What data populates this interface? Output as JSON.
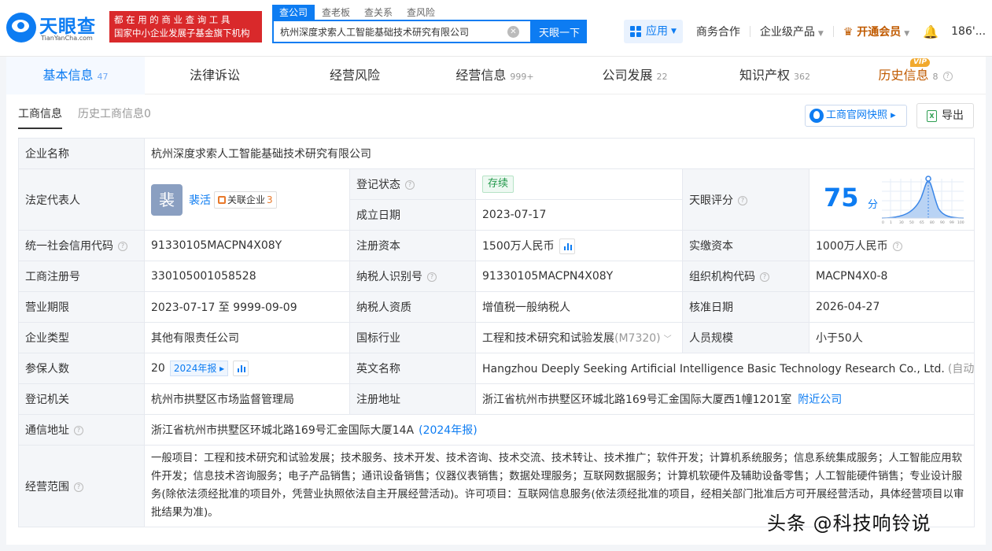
{
  "header": {
    "logo_text": "天眼查",
    "logo_domain": "TianYanCha.com",
    "slogan_line1": "都在用的商业查询工具",
    "slogan_line2": "国家中小企业发展子基金旗下机构",
    "search_tabs": [
      "查公司",
      "查老板",
      "查关系",
      "查风险"
    ],
    "search_value": "杭州深度求索人工智能基础技术研究有限公司",
    "clear_symbol": "✕",
    "search_button": "天眼一下",
    "nav": {
      "apps": "应用",
      "business": "商务合作",
      "enterprise": "企业级产品",
      "vip": "开通会员",
      "vip_icon": "♛",
      "bell_icon": "🔔",
      "user": "186'..."
    }
  },
  "tabs": [
    {
      "label": "基本信息",
      "count": "47"
    },
    {
      "label": "法律诉讼",
      "count": ""
    },
    {
      "label": "经营风险",
      "count": ""
    },
    {
      "label": "经营信息",
      "count": "999+"
    },
    {
      "label": "公司发展",
      "count": "22"
    },
    {
      "label": "知识产权",
      "count": "362"
    },
    {
      "label": "历史信息",
      "count": "8",
      "badge": "VIP"
    }
  ],
  "subtabs": [
    "工商信息",
    "历史工商信息0"
  ],
  "actions": {
    "snapshot": "工商官网快照",
    "snapshot_arrow": "▸",
    "export": "导出",
    "export_icon": "X"
  },
  "info": {
    "company_name_label": "企业名称",
    "company_name": "杭州深度求索人工智能基础技术研究有限公司",
    "legal_rep_label": "法定代表人",
    "legal_rep_avatar": "裴",
    "legal_rep_name": "裴活",
    "related_label": "关联企业",
    "related_count": "3",
    "reg_status_label": "登记状态",
    "reg_status": "存续",
    "founded_label": "成立日期",
    "founded": "2023-07-17",
    "score_label": "天眼评分",
    "score": "75",
    "score_unit": "分",
    "credit_code_label": "统一社会信用代码",
    "credit_code": "91330105MACPN4X08Y",
    "reg_capital_label": "注册资本",
    "reg_capital": "1500万人民币",
    "paid_capital_label": "实缴资本",
    "paid_capital": "1000万人民币",
    "reg_no_label": "工商注册号",
    "reg_no": "330105001058528",
    "taxpayer_id_label": "纳税人识别号",
    "taxpayer_id": "91330105MACPN4X08Y",
    "org_code_label": "组织机构代码",
    "org_code": "MACPN4X0-8",
    "term_label": "营业期限",
    "term": "2023-07-17 至 9999-09-09",
    "taxpayer_qual_label": "纳税人资质",
    "taxpayer_qual": "增值税一般纳税人",
    "approval_date_label": "核准日期",
    "approval_date": "2026-04-27",
    "type_label": "企业类型",
    "type": "其他有限责任公司",
    "industry_label": "国标行业",
    "industry": "工程和技术研究和试验发展",
    "industry_code": "(M7320)",
    "staff_size_label": "人员规模",
    "staff_size": "小于50人",
    "insured_label": "参保人数",
    "insured": "20",
    "insured_year": "2024年报 ▸",
    "english_name_label": "英文名称",
    "english_name": "Hangzhou Deeply Seeking Artificial Intelligence Basic Technology Research Co., Ltd.",
    "auto_translate": "(自动翻译)",
    "authority_label": "登记机关",
    "authority": "杭州市拱墅区市场监督管理局",
    "reg_address_label": "注册地址",
    "reg_address": "浙江省杭州市拱墅区环城北路169号汇金国际大厦西1幢1201室",
    "nearby": "附近公司",
    "mail_address_label": "通信地址",
    "mail_address": "浙江省杭州市拱墅区环城北路169号汇金国际大厦14A",
    "mail_year": "(2024年报)",
    "scope_label": "经营范围",
    "scope": "一般项目：工程和技术研究和试验发展；技术服务、技术开发、技术咨询、技术交流、技术转让、技术推广；软件开发；计算机系统服务；信息系统集成服务；人工智能应用软件开发；信息技术咨询服务；电子产品销售；通讯设备销售；仪器仪表销售；数据处理服务；互联网数据服务；计算机软硬件及辅助设备零售；人工智能硬件销售；专业设计服务(除依法须经批准的项目外，凭营业执照依法自主开展经营活动)。许可项目：互联网信息服务(依法须经批准的项目，经相关部门批准后方可开展经营活动，具体经营项目以审批结果为准)。"
  },
  "watermark": "头条 @科技响铃说",
  "colors": {
    "brand": "#0d7cf2",
    "slogan_bg": "#d9292b",
    "vip": "#c05a00",
    "status_green": "#23994b"
  }
}
